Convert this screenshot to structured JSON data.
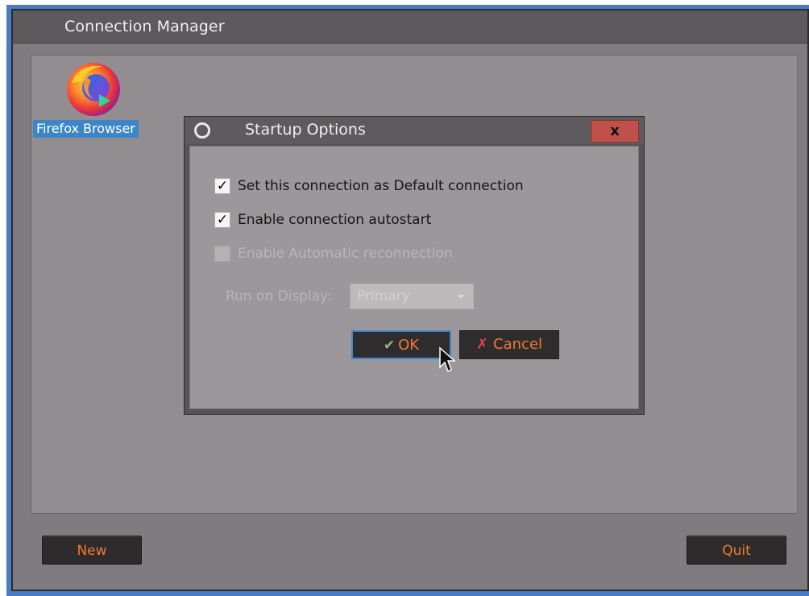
{
  "window": {
    "title": "Connection Manager"
  },
  "connections": [
    {
      "label": "Firefox Browser",
      "icon": "firefox-icon",
      "selected": true
    }
  ],
  "buttons": {
    "new_label": "New",
    "quit_label": "Quit"
  },
  "dialog": {
    "title": "Startup Options",
    "close_label": "x",
    "options": [
      {
        "label": "Set this connection as Default connection",
        "checked": true,
        "enabled": true
      },
      {
        "label": "Enable connection autostart",
        "checked": true,
        "enabled": true
      },
      {
        "label": "Enable Automatic reconnection",
        "checked": false,
        "enabled": false
      }
    ],
    "display_label": "Run on Display:",
    "display_value": "Primary",
    "ok_label": "OK",
    "cancel_label": "Cancel",
    "ok_icon": "ok-check-icon",
    "cancel_icon": "cancel-x-icon"
  },
  "colors": {
    "accent_text": "#f07a30",
    "selection": "#3c86c8",
    "frame": "#4a7cc4"
  }
}
